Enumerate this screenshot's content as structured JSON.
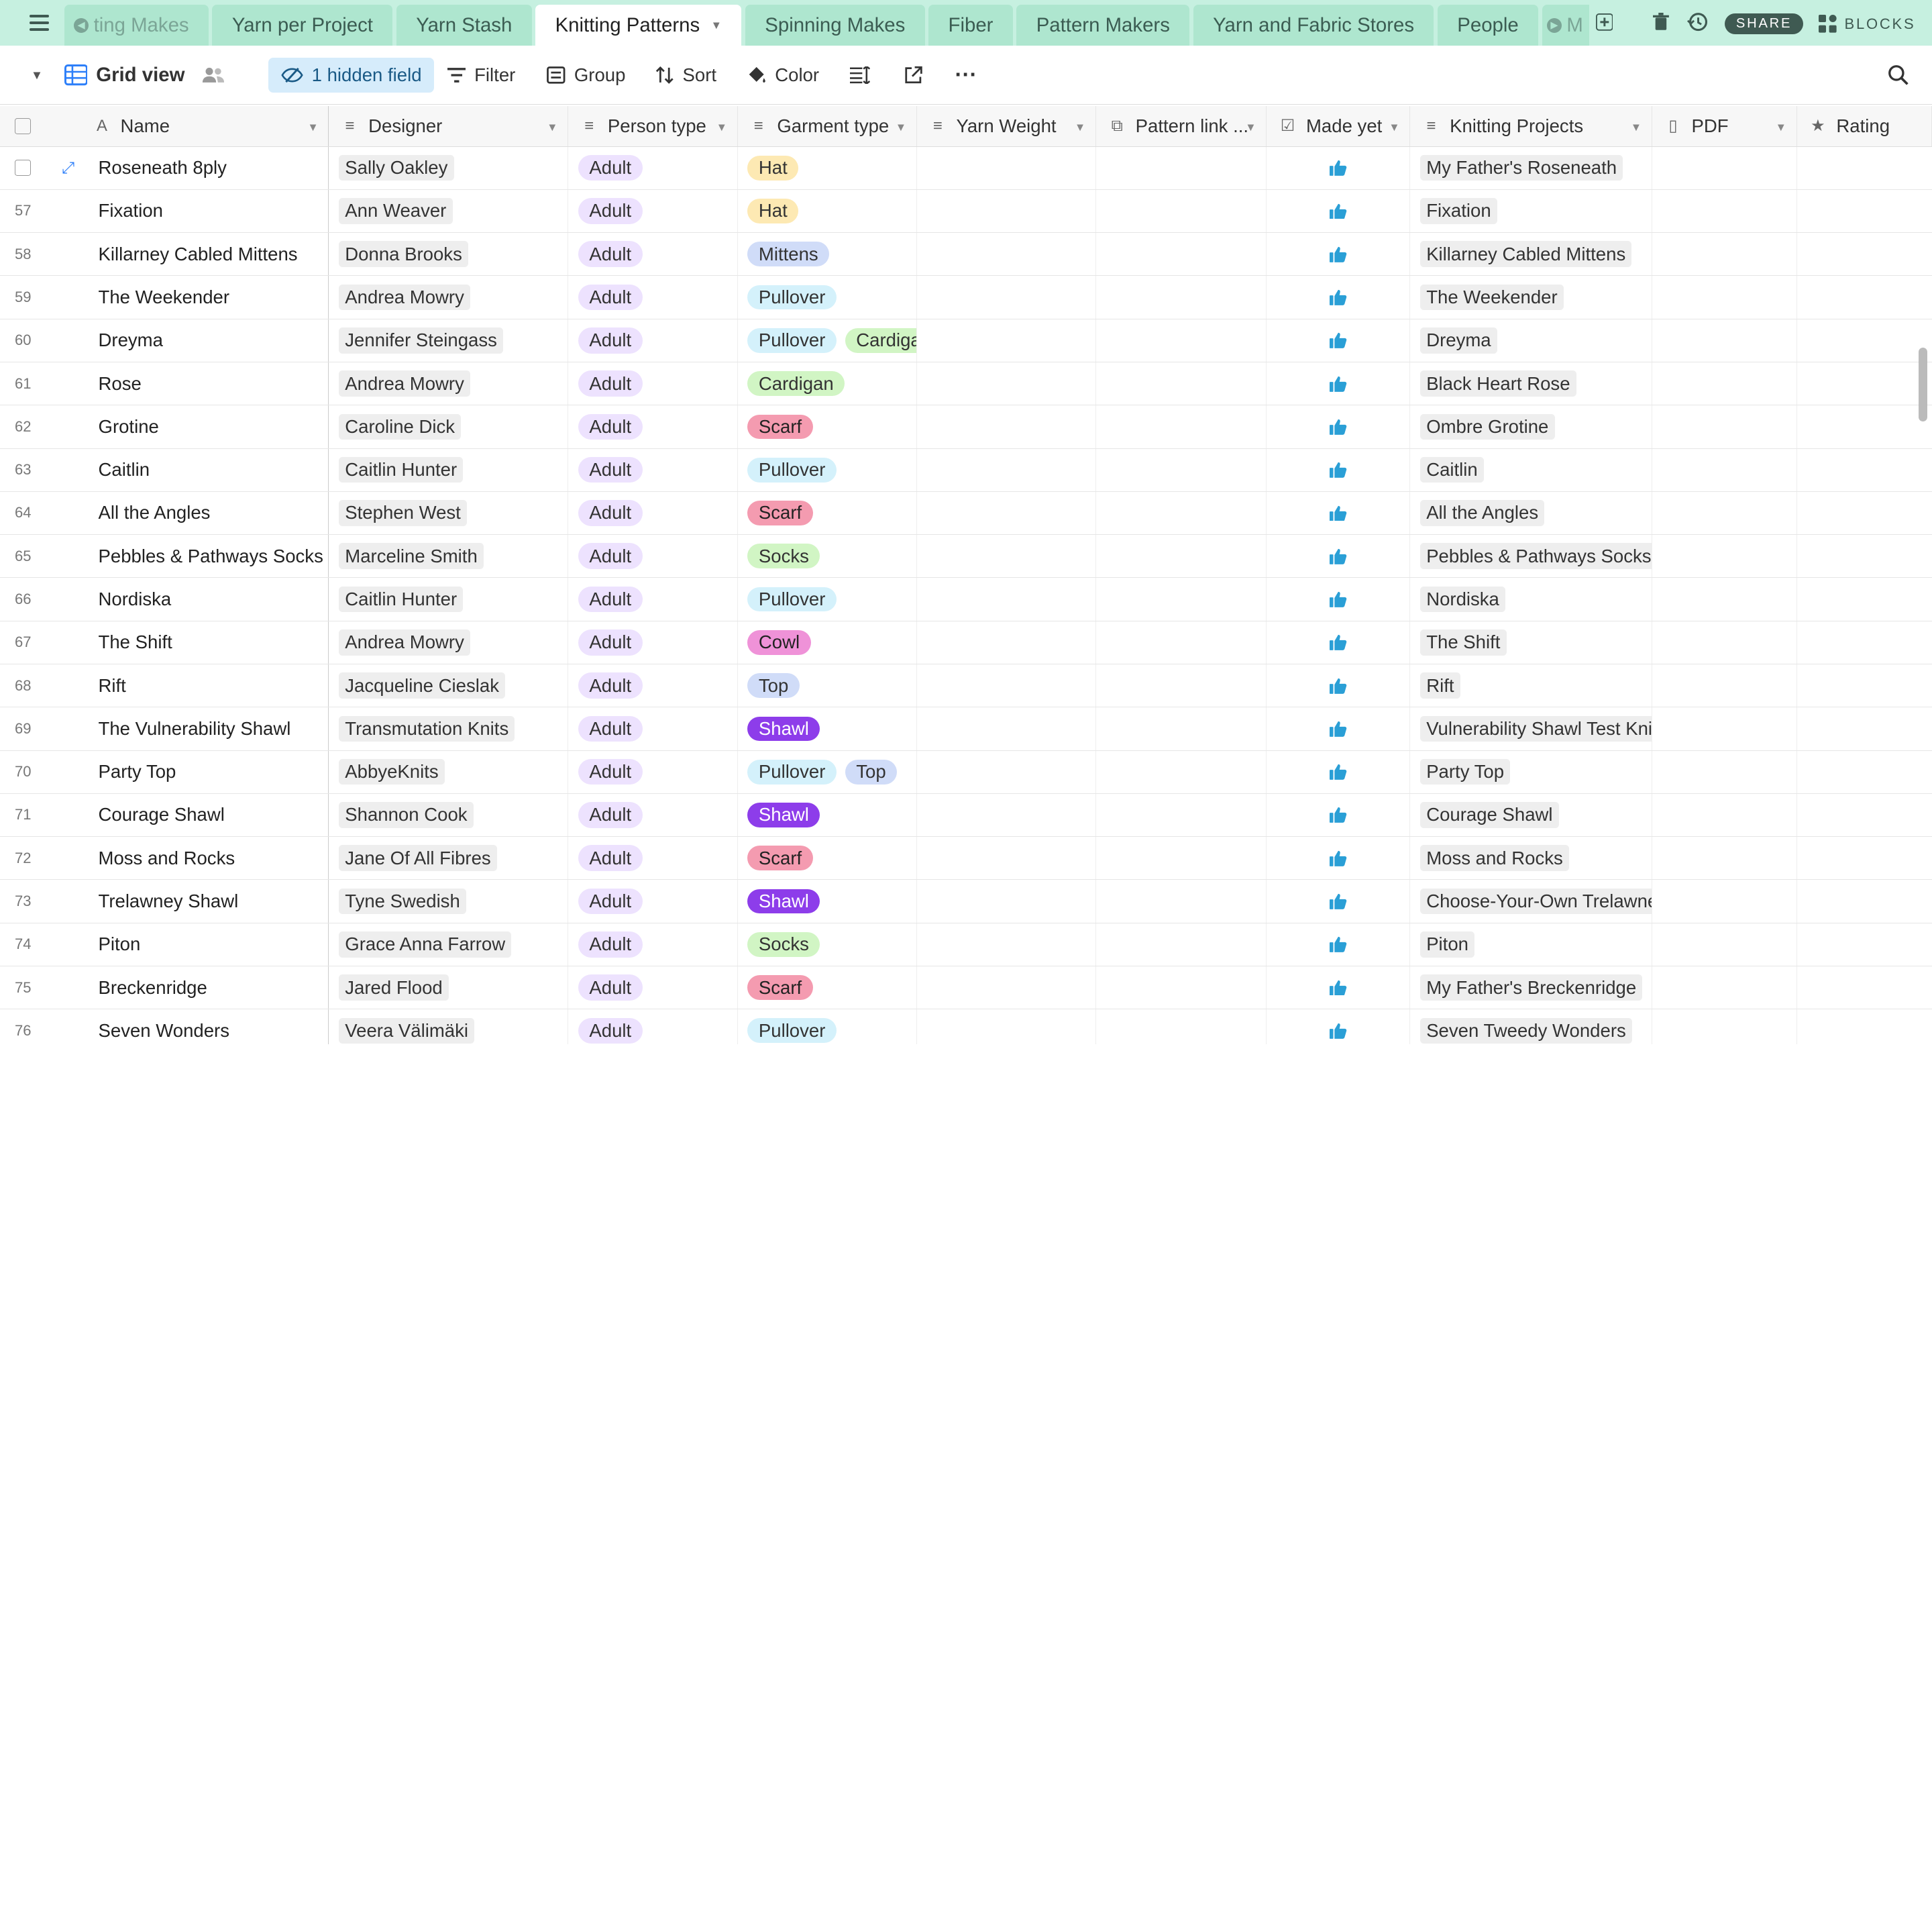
{
  "tabs": [
    {
      "label": "ting Makes",
      "active": false,
      "faded": true
    },
    {
      "label": "Yarn per Project",
      "active": false
    },
    {
      "label": "Yarn Stash",
      "active": false
    },
    {
      "label": "Knitting Patterns",
      "active": true
    },
    {
      "label": "Spinning Makes",
      "active": false
    },
    {
      "label": "Fiber",
      "active": false
    },
    {
      "label": "Pattern Makers",
      "active": false
    },
    {
      "label": "Yarn and Fabric Stores",
      "active": false
    },
    {
      "label": "People",
      "active": false
    },
    {
      "label": "M",
      "active": false,
      "faded": true
    }
  ],
  "topbar": {
    "share_label": "SHARE",
    "blocks_label": "BLOCKS"
  },
  "toolbar": {
    "view_name": "Grid view",
    "hidden_field": "1 hidden field",
    "filter": "Filter",
    "group": "Group",
    "sort": "Sort",
    "color": "Color"
  },
  "columns": [
    {
      "label": "Name",
      "icon": "A"
    },
    {
      "label": "Designer",
      "icon": "≡"
    },
    {
      "label": "Person type",
      "icon": "≡"
    },
    {
      "label": "Garment type",
      "icon": "≡"
    },
    {
      "label": "Yarn Weight",
      "icon": "≡"
    },
    {
      "label": "Pattern link ...",
      "icon": "⧉"
    },
    {
      "label": "Made yet",
      "icon": "☑"
    },
    {
      "label": "Knitting Projects",
      "icon": "≡"
    },
    {
      "label": "PDF",
      "icon": "▯"
    },
    {
      "label": "Rating",
      "icon": "★"
    }
  ],
  "pill_colors": {
    "Hat": {
      "bg": "#fde9b3",
      "fg": "#333"
    },
    "Mittens": {
      "bg": "#d0dcf8",
      "fg": "#333"
    },
    "Pullover": {
      "bg": "#d4f1fb",
      "fg": "#333"
    },
    "Cardigan": {
      "bg": "#d1f5c4",
      "fg": "#333"
    },
    "Scarf": {
      "bg": "#f49bb0",
      "fg": "#222"
    },
    "Socks": {
      "bg": "#d1f5c4",
      "fg": "#333"
    },
    "Cowl": {
      "bg": "#ef92d8",
      "fg": "#222"
    },
    "Top": {
      "bg": "#d0dcf8",
      "fg": "#333"
    },
    "Shawl": {
      "bg": "#8d3dea",
      "fg": "#fff"
    }
  },
  "rows": [
    {
      "num": "",
      "name": "Roseneath 8ply",
      "designer": "Sally Oakley",
      "person": "Adult",
      "garment": [
        "Hat"
      ],
      "project": "My Father's Roseneath",
      "first": true
    },
    {
      "num": "57",
      "name": "Fixation",
      "designer": "Ann Weaver",
      "person": "Adult",
      "garment": [
        "Hat"
      ],
      "project": "Fixation"
    },
    {
      "num": "58",
      "name": "Killarney Cabled Mittens",
      "designer": "Donna Brooks",
      "person": "Adult",
      "garment": [
        "Mittens"
      ],
      "project": "Killarney Cabled Mittens"
    },
    {
      "num": "59",
      "name": "The Weekender",
      "designer": "Andrea Mowry",
      "person": "Adult",
      "garment": [
        "Pullover"
      ],
      "project": "The Weekender"
    },
    {
      "num": "60",
      "name": "Dreyma",
      "designer": "Jennifer Steingass",
      "person": "Adult",
      "garment": [
        "Pullover",
        "Cardigan"
      ],
      "project": "Dreyma"
    },
    {
      "num": "61",
      "name": "Rose",
      "designer": "Andrea Mowry",
      "person": "Adult",
      "garment": [
        "Cardigan"
      ],
      "project": "Black Heart Rose"
    },
    {
      "num": "62",
      "name": "Grotine",
      "designer": "Caroline Dick",
      "person": "Adult",
      "garment": [
        "Scarf"
      ],
      "project": "Ombre Grotine"
    },
    {
      "num": "63",
      "name": "Caitlin",
      "designer": "Caitlin Hunter",
      "person": "Adult",
      "garment": [
        "Pullover"
      ],
      "project": "Caitlin"
    },
    {
      "num": "64",
      "name": "All the Angles",
      "designer": "Stephen West",
      "person": "Adult",
      "garment": [
        "Scarf"
      ],
      "project": "All the Angles"
    },
    {
      "num": "65",
      "name": "Pebbles & Pathways Socks",
      "designer": "Marceline Smith",
      "person": "Adult",
      "garment": [
        "Socks"
      ],
      "project": "Pebbles & Pathways Socks"
    },
    {
      "num": "66",
      "name": "Nordiska",
      "designer": "Caitlin Hunter",
      "person": "Adult",
      "garment": [
        "Pullover"
      ],
      "project": "Nordiska"
    },
    {
      "num": "67",
      "name": "The Shift",
      "designer": "Andrea Mowry",
      "person": "Adult",
      "garment": [
        "Cowl"
      ],
      "project": "The Shift"
    },
    {
      "num": "68",
      "name": "Rift",
      "designer": "Jacqueline Cieslak",
      "person": "Adult",
      "garment": [
        "Top"
      ],
      "project": "Rift"
    },
    {
      "num": "69",
      "name": "The Vulnerability Shawl",
      "designer": "Transmutation Knits",
      "person": "Adult",
      "garment": [
        "Shawl"
      ],
      "project": "Vulnerability Shawl Test Knit"
    },
    {
      "num": "70",
      "name": "Party Top",
      "designer": "AbbyeKnits",
      "person": "Adult",
      "garment": [
        "Pullover",
        "Top"
      ],
      "project": "Party Top"
    },
    {
      "num": "71",
      "name": "Courage Shawl",
      "designer": "Shannon Cook",
      "person": "Adult",
      "garment": [
        "Shawl"
      ],
      "project": "Courage Shawl"
    },
    {
      "num": "72",
      "name": "Moss and Rocks",
      "designer": "Jane Of All Fibres",
      "person": "Adult",
      "garment": [
        "Scarf"
      ],
      "project": "Moss and Rocks"
    },
    {
      "num": "73",
      "name": "Trelawney Shawl",
      "designer": "Tyne Swedish",
      "person": "Adult",
      "garment": [
        "Shawl"
      ],
      "project": "Choose-Your-Own Trelawney"
    },
    {
      "num": "74",
      "name": "Piton",
      "designer": "Grace Anna Farrow",
      "person": "Adult",
      "garment": [
        "Socks"
      ],
      "project": "Piton"
    },
    {
      "num": "75",
      "name": "Breckenridge",
      "designer": "Jared Flood",
      "person": "Adult",
      "garment": [
        "Scarf"
      ],
      "project": "My Father's Breckenridge"
    },
    {
      "num": "76",
      "name": "Seven Wonders",
      "designer": "Veera Välimäki",
      "person": "Adult",
      "garment": [
        "Pullover"
      ],
      "project": "Seven Tweedy Wonders"
    }
  ]
}
